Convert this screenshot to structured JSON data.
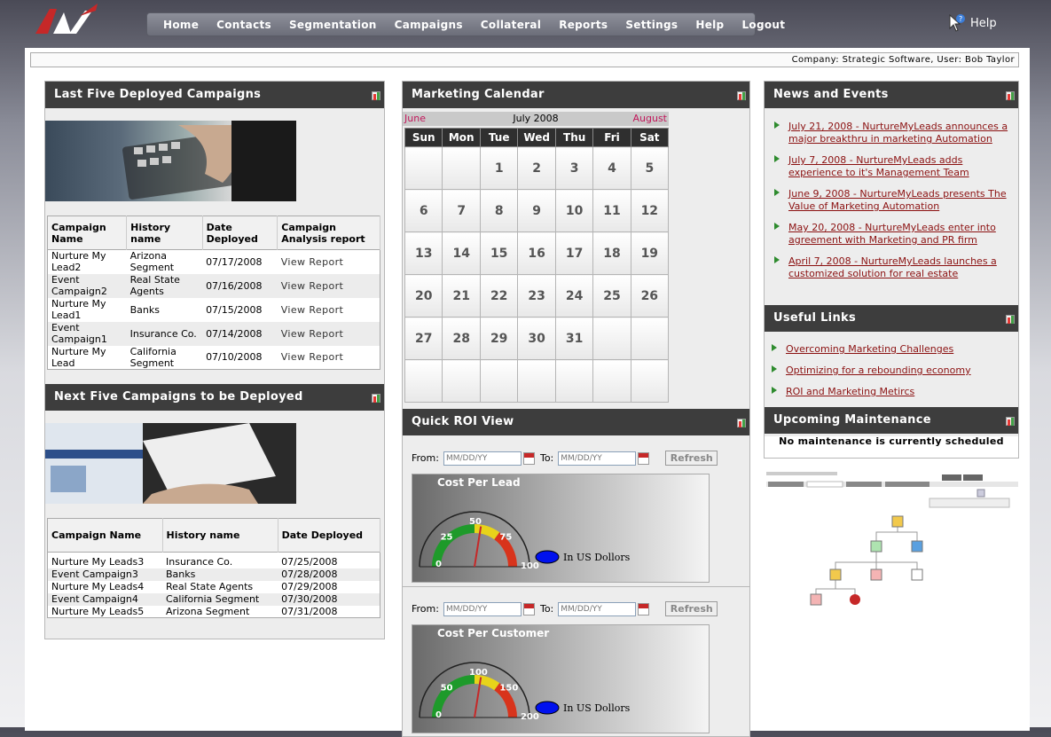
{
  "nav": {
    "items": [
      "Home",
      "Contacts",
      "Segmentation",
      "Campaigns",
      "Collateral",
      "Reports",
      "Settings",
      "Help",
      "Logout"
    ],
    "help_label": "Help"
  },
  "infobar": {
    "text": "Company: Strategic Software, User: Bob Taylor"
  },
  "last_five": {
    "title": "Last Five Deployed Campaigns",
    "headers": [
      "Campaign Name",
      "History name",
      "Date Deployed",
      "Campaign Analysis report"
    ],
    "rows": [
      {
        "name": "Nurture My Lead2",
        "history": "Arizona Segment",
        "date": "07/17/2008",
        "report": "View Report"
      },
      {
        "name": "Event Campaign2",
        "history": "Real State Agents",
        "date": "07/16/2008",
        "report": "View Report"
      },
      {
        "name": "Nurture My Lead1",
        "history": "Banks",
        "date": "07/15/2008",
        "report": "View Report"
      },
      {
        "name": "Event Campaign1",
        "history": "Insurance Co.",
        "date": "07/14/2008",
        "report": "View Report"
      },
      {
        "name": "Nurture My Lead",
        "history": "California Segment",
        "date": "07/10/2008",
        "report": "View Report"
      }
    ]
  },
  "next_five": {
    "title": "Next Five Campaigns to be Deployed",
    "headers": [
      "Campaign Name",
      "History name",
      "Date Deployed"
    ],
    "rows": [
      {
        "name": "Nurture My Leads3",
        "history": "Insurance Co.",
        "date": "07/25/2008"
      },
      {
        "name": "Event Campaign3",
        "history": "Banks",
        "date": "07/28/2008"
      },
      {
        "name": "Nurture My Leads4",
        "history": "Real State Agents",
        "date": "07/29/2008"
      },
      {
        "name": "Event Campaign4",
        "history": "California Segment",
        "date": "07/30/2008"
      },
      {
        "name": "Nurture My Leads5",
        "history": "Arizona Segment",
        "date": "07/31/2008"
      }
    ]
  },
  "calendar": {
    "title": "Marketing Calendar",
    "prev": "June",
    "current": "July 2008",
    "next": "August",
    "weekdays": [
      "Sun",
      "Mon",
      "Tue",
      "Wed",
      "Thu",
      "Fri",
      "Sat"
    ],
    "weeks": [
      [
        "",
        "",
        "1",
        "2",
        "3",
        "4",
        "5"
      ],
      [
        "6",
        "7",
        "8",
        "9",
        "10",
        "11",
        "12"
      ],
      [
        "13",
        "14",
        "15",
        "16",
        "17",
        "18",
        "19"
      ],
      [
        "20",
        "21",
        "22",
        "23",
        "24",
        "25",
        "26"
      ],
      [
        "27",
        "28",
        "29",
        "30",
        "31",
        "",
        ""
      ],
      [
        "",
        "",
        "",
        "",
        "",
        "",
        ""
      ]
    ]
  },
  "roi": {
    "title": "Quick ROI View",
    "from_label": "From:",
    "to_label": "To:",
    "placeholder": "MM/DD/YY",
    "refresh": "Refresh",
    "gauges": [
      {
        "title": "Cost Per Lead",
        "ticks": [
          "0",
          "25",
          "50",
          "75",
          "100"
        ],
        "legend": "In US Dollors"
      },
      {
        "title": "Cost Per Customer",
        "ticks": [
          "0",
          "50",
          "100",
          "150",
          "200"
        ],
        "legend": "In US Dollors"
      }
    ]
  },
  "news": {
    "title": "News and Events",
    "items": [
      "July 21, 2008 - NurtureMyLeads announces a major breakthru in marketing Automation",
      "July 7, 2008 - NurtureMyLeads adds experience to it's Management Team",
      "June 9, 2008 - NurtureMyLeads presents The Value of Marketing Automation",
      "May 20, 2008 - NurtureMyLeads enter into agreement with Marketing and PR firm",
      "April 7, 2008 - NurtureMyLeads launches a customized solution for real estate"
    ]
  },
  "links": {
    "title": "Useful Links",
    "items": [
      "Overcoming Marketing Challenges",
      "Optimizing for a rebounding economy",
      "ROI and Marketing Metircs"
    ]
  },
  "maintenance": {
    "title": "Upcoming Maintenance",
    "text": "No maintenance is currently scheduled"
  },
  "colors": {
    "header_dark": "#3d3d3d",
    "link_red": "#8b1111",
    "accent_pink": "#c2185b"
  }
}
